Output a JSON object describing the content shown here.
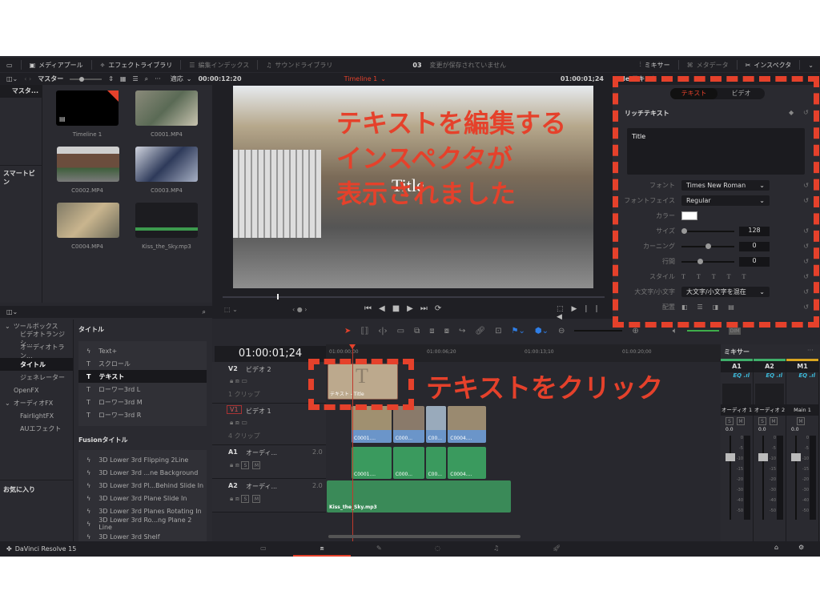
{
  "topbar": {
    "media_pool": "メディアプール",
    "effects_library": "エフェクトライブラリ",
    "edit_index": "編集インデックス",
    "sound_library": "サウンドライブラリ",
    "project_number": "03",
    "unsaved": "変更が保存されていません",
    "mixer": "ミキサー",
    "metadata": "メタデータ",
    "inspector": "インスペクタ"
  },
  "subbar": {
    "bin": "マスター",
    "fit": "適応",
    "source_tc": "00:00:12:20",
    "timeline_name": "Timeline 1",
    "timeline_tc": "01:00:01;24",
    "inspector_title": "Title テキスト"
  },
  "media_pool": {
    "bins": [
      "マスタ...",
      "スマートビン"
    ],
    "clips": [
      {
        "name": "Timeline 1"
      },
      {
        "name": "C0001.MP4"
      },
      {
        "name": "C0002.MP4"
      },
      {
        "name": "C0003.MP4"
      },
      {
        "name": "C0004.MP4"
      },
      {
        "name": "Kiss_the_Sky.mp3"
      }
    ]
  },
  "viewer": {
    "overlay_title": "Title"
  },
  "inspector": {
    "tabs": [
      "テキスト",
      "ビデオ"
    ],
    "active_tab": "テキスト",
    "section": "リッチテキスト",
    "text_value": "Title",
    "font_label": "フォント",
    "font": "Times New Roman",
    "face_label": "フォントフェイス",
    "face": "Regular",
    "color_label": "カラー",
    "color": "#ffffff",
    "size_label": "サイズ",
    "size": "128",
    "kerning_label": "カーニング",
    "kerning": "0",
    "line_label": "行間",
    "line_spacing": "0",
    "style_label": "スタイル",
    "case_label": "大文字/小文字",
    "case": "大文字/小文字を混在",
    "align_label": "配置"
  },
  "effects": {
    "tree": [
      "ツールボックス",
      "ビデオトランジシ...",
      "オーディオトラン...",
      "タイトル",
      "ジェネレーター",
      "OpenFX",
      "オーディオFX",
      "FairlightFX",
      "AUエフェクト"
    ],
    "active": "タイトル",
    "favorites": "お気に入り",
    "titles_header": "タイトル",
    "titles": [
      "Text+",
      "スクロール",
      "テキスト",
      "ローワー3rd L",
      "ローワー3rd M",
      "ローワー3rd R"
    ],
    "selected_title": "テキスト",
    "fusion_header": "Fusionタイトル",
    "fusion_titles": [
      "3D Lower 3rd Flipping 2Line",
      "3D Lower 3rd ...ne Background",
      "3D Lower 3rd Pl...Behind Slide In",
      "3D Lower 3rd Plane Slide In",
      "3D Lower 3rd Planes Rotating In",
      "3D Lower 3rd Ro...ng Plane 2 Line",
      "3D Lower 3rd Shelf"
    ]
  },
  "timeline": {
    "timecode": "01:00:01;24",
    "ruler": [
      "01:00:00;00",
      "01:00:06;20",
      "01:00:13;10",
      "01:00:20;00"
    ],
    "tracks": [
      {
        "id": "V2",
        "name": "ビデオ 2",
        "count": "1 クリップ"
      },
      {
        "id": "V1",
        "name": "ビデオ 1",
        "count": "4 クリップ"
      },
      {
        "id": "A1",
        "name": "オーディ...",
        "ch": "2.0"
      },
      {
        "id": "A2",
        "name": "オーディ...",
        "ch": "2.0"
      }
    ],
    "title_clip": "テキスト - Title",
    "video_clips": [
      "C0001....",
      "C000...",
      "C00...",
      "C0004...."
    ],
    "audio_clips": [
      "C0001....",
      "C000...",
      "C00...",
      "C0004...."
    ],
    "music_clip": "Kiss_the_Sky.mp3",
    "dim": "DIM"
  },
  "mixer": {
    "title": "ミキサー",
    "channels": [
      {
        "id": "A1",
        "name": "オーディオ 1",
        "level": "0.0",
        "color": "#3fae6a"
      },
      {
        "id": "A2",
        "name": "オーディオ 2",
        "level": "0.0",
        "color": "#3fae6a"
      },
      {
        "id": "M1",
        "name": "Main 1",
        "level": "0.0",
        "color": "#d9a520"
      }
    ],
    "eq": "EQ",
    "scale": [
      "0",
      "-5",
      "-10",
      "-15",
      "-20",
      "-30",
      "-40",
      "-50"
    ]
  },
  "bottom": {
    "app_name": "DaVinci Resolve 15"
  },
  "annotations": {
    "inspector_note": [
      "テキストを編集する",
      "インスペクタが",
      "表示されました"
    ],
    "click_note": "テキストをクリック",
    "color": "#e5412b"
  }
}
